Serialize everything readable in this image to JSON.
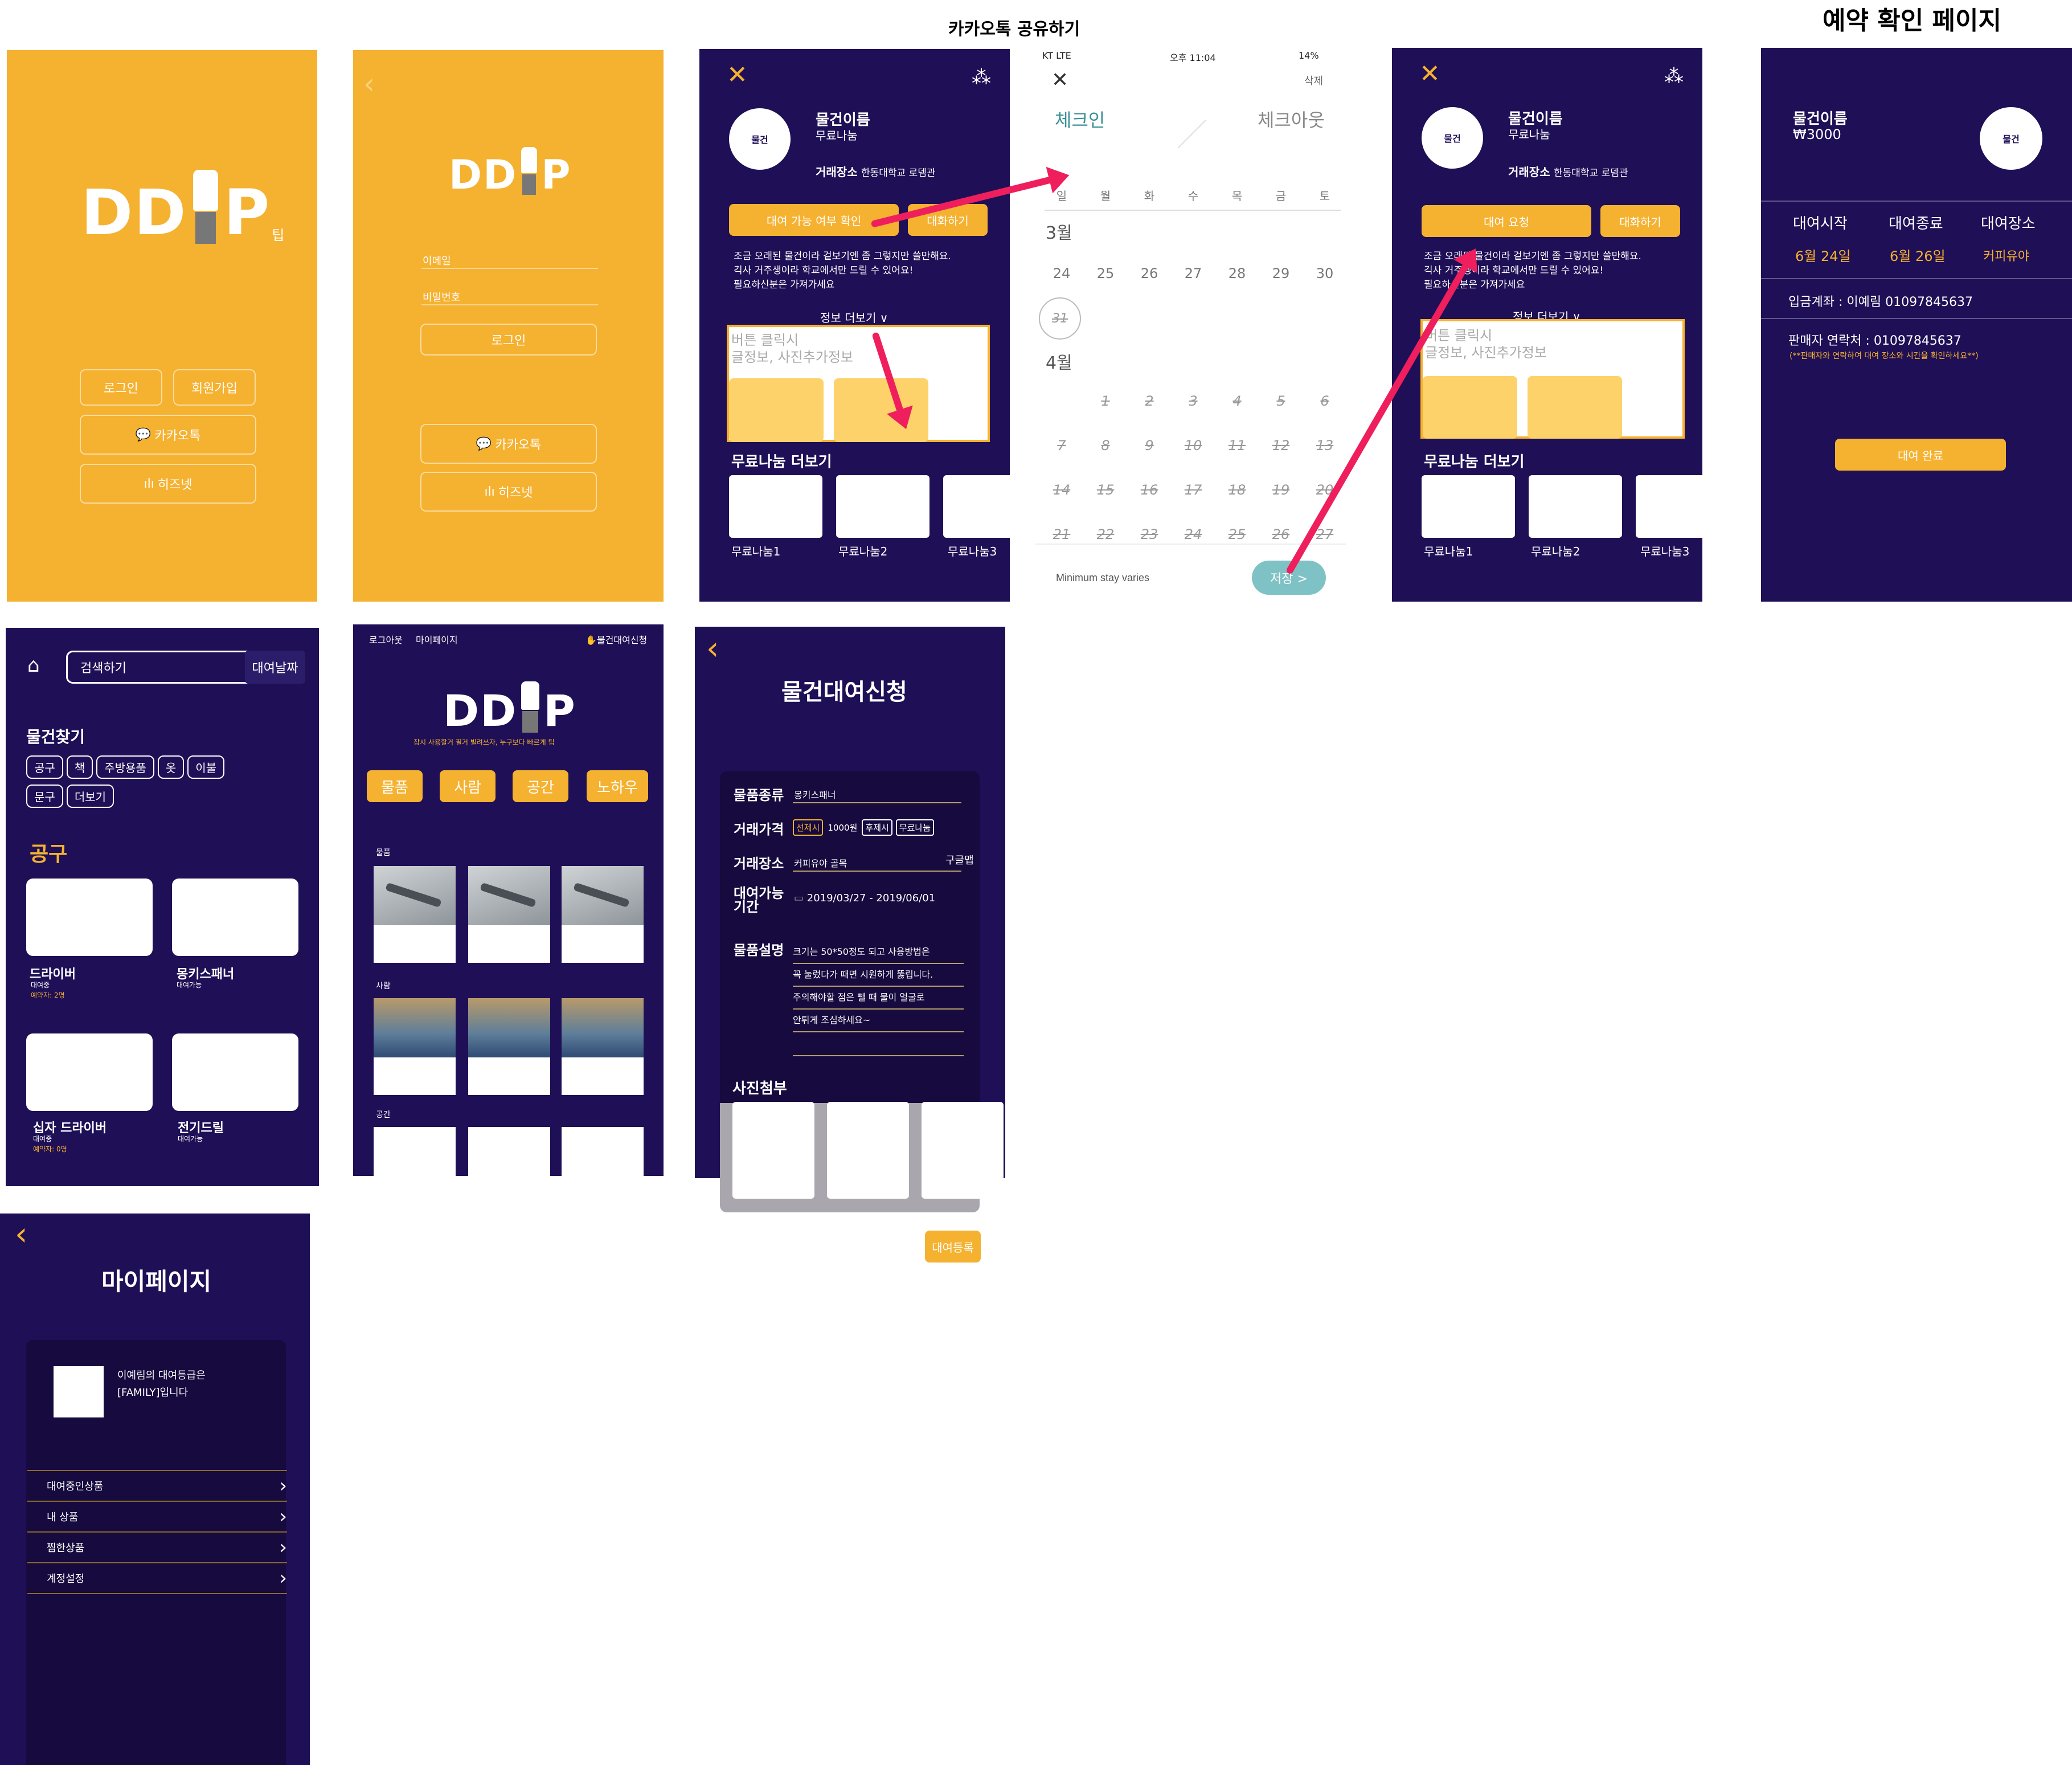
{
  "labels": {
    "kakao_share": "카카오톡 공유하기",
    "reservation_confirm": "예약 확인 페이지"
  },
  "login_home": {
    "logo": "DD",
    "logo_p": "P",
    "logo_sub": "팁",
    "login": "로그인",
    "signup": "회원가입",
    "kakao": "카카오톡",
    "hisnet": "히즈넷"
  },
  "login_form": {
    "logo": "DD",
    "logo_p": "P",
    "email_label": "이메일",
    "password_label": "비밀번호",
    "login": "로그인",
    "kakao": "카카오톡",
    "hisnet": "히즈넷"
  },
  "item_detail": {
    "avatar": "물건",
    "name": "물건이름",
    "type": "무료나눔",
    "place_label": "거래장소",
    "place": "한동대학교 로뎀관",
    "btn_check": "대여 가능 여부 확인",
    "btn_chat": "대화하기",
    "desc": [
      "조금 오래된 물건이라 겉보기엔 좀 그렇지만 쓸만해요.",
      "긱사 거주생이라 학교에서만 드릴 수 있어요!",
      "필요하신분은 가져가세요"
    ],
    "more_info": "정보 더보기 ∨",
    "hint": [
      "버튼 클릭시",
      "글정보, 사진추가정보"
    ],
    "free_more": "무료나눔 더보기",
    "free_items": [
      "무료나눔1",
      "무료나눔2",
      "무료나눔3"
    ]
  },
  "calendar": {
    "status_left": "KT  LTE",
    "status_time": "오후 11:04",
    "status_right": "14%",
    "delete": "삭제",
    "checkin": "체크인",
    "checkout": "체크아웃",
    "weekdays": [
      "일",
      "월",
      "화",
      "수",
      "목",
      "금",
      "토"
    ],
    "month1": "3월",
    "month1_row1": [
      "24",
      "25",
      "26",
      "27",
      "28",
      "29",
      "30"
    ],
    "month1_row2": [
      "31"
    ],
    "month2": "4월",
    "month2_rows": [
      [
        "1",
        "2",
        "3",
        "4",
        "5",
        "6"
      ],
      [
        "7",
        "8",
        "9",
        "10",
        "11",
        "12",
        "13"
      ],
      [
        "14",
        "15",
        "16",
        "17",
        "18",
        "19",
        "20"
      ],
      [
        "21",
        "22",
        "23",
        "24",
        "25",
        "26",
        "27"
      ]
    ],
    "footer": "Minimum stay varies",
    "save": "저장 >"
  },
  "item_detail2": {
    "avatar": "물건",
    "name": "물건이름",
    "type": "무료나눔",
    "place_label": "거래장소",
    "place": "한동대학교 로뎀관",
    "btn_request": "대여 요청",
    "btn_chat": "대화하기",
    "desc": [
      "조금 오래된 물건이라 겉보기엔 좀 그렇지만 쓸만해요.",
      "긱사 거주생이라 학교에서만 드릴 수 있어요!",
      "필요하신분은 가져가세요"
    ],
    "more_info": "정보 더보기 ∨",
    "hint": [
      "버튼 클릭시",
      "글정보, 사진추가정보"
    ],
    "free_more": "무료나눔 더보기",
    "free_items": [
      "무료나눔1",
      "무료나눔2",
      "무료나눔3"
    ]
  },
  "confirm": {
    "name": "물건이름",
    "price": "₩3000",
    "avatar": "물건",
    "start_label": "대여시작",
    "end_label": "대여종료",
    "place_label": "대여장소",
    "start": "6월 24일",
    "end": "6월 26일",
    "place": "커피유야",
    "account": "입금계좌 : 이예림 01097845637",
    "seller": "판매자 연락처 :  01097845637",
    "seller_note": "(**판매자와 연락하여 대여 장소와 시간을 확인하세요**)",
    "done": "대여 완료"
  },
  "search": {
    "search_placeholder": "검색하기",
    "rental_date": "대여날짜",
    "find": "물건찾기",
    "chips_row1": [
      "공구",
      "책",
      "주방용품",
      "옷",
      "이불"
    ],
    "chips_row2": [
      "문구",
      "더보기"
    ],
    "section": "공구",
    "items": [
      {
        "name": "드라이버",
        "status": "대여중",
        "extra": "예약자: 2명"
      },
      {
        "name": "몽키스패너",
        "status": "대여가능",
        "extra": ""
      },
      {
        "name": "십자 드라이버",
        "status": "대여중",
        "extra": "예약자: 0명"
      },
      {
        "name": "전기드릴",
        "status": "대여가능",
        "extra": ""
      }
    ]
  },
  "main": {
    "logout": "로그아웃",
    "mypage": "마이페이지",
    "rental_request": "물건대여신청",
    "logo": "DD",
    "logo_p": "P",
    "tagline": "잠시 사용할거 필거 빌려쓰자, 누구보다 빠르게 팁",
    "tabs": [
      "물품",
      "사람",
      "공간",
      "노하우"
    ],
    "sec1": "물품",
    "sec2": "사람",
    "sec3": "공간"
  },
  "rental_form": {
    "title": "물건대여신청",
    "kind_label": "물품종류",
    "kind": "몽키스패너",
    "price_label": "거래가격",
    "price_opts": [
      "선제시",
      "1000원",
      "후제시",
      "무료나눔"
    ],
    "place_label": "거래장소",
    "place": "커피유야 골목",
    "map": "구글맵",
    "period_label": [
      "대여가능",
      "기간"
    ],
    "period": "2019/03/27 - 2019/06/01",
    "desc_label": "물품설명",
    "desc": [
      "크기는 50*50정도 되고 사용방법은",
      "꼭 눌렀다가 때면 시원하게 뚫립니다.",
      "주의해야할 점은 뺄 때 물이 얼굴로",
      "안튀게 조심하세요~"
    ],
    "photo_label": "사진첨부",
    "register": "대여등록"
  },
  "mypage": {
    "title": "마이페이지",
    "grade": [
      "이예림의 대여등급은",
      "[FAMILY]입니다"
    ],
    "menu": [
      "대여중인상품",
      "내 상품",
      "찜한상품",
      "계정설정"
    ]
  },
  "colors": {
    "yellow": "#f5b130",
    "navy": "#1e0f56",
    "arrow": "#ee1f5c",
    "teal": "#3a8f98"
  }
}
